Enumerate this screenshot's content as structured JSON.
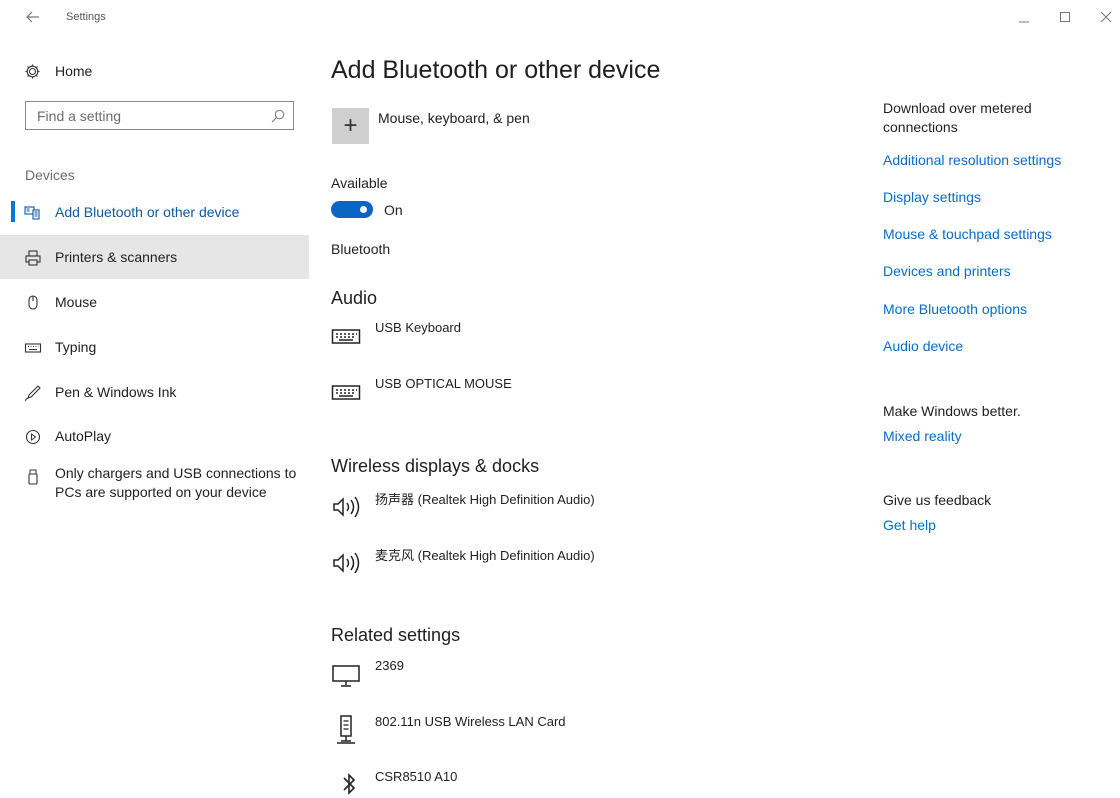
{
  "window": {
    "title": "Settings"
  },
  "sidebar": {
    "home_label": "Home",
    "search_placeholder": "Find a setting",
    "section_label": "Devices",
    "items": [
      {
        "label": "Add Bluetooth or other device",
        "icon": "bluetooth-devices-icon",
        "active": true
      },
      {
        "label": "Printers & scanners",
        "icon": "printer-icon"
      },
      {
        "label": "Mouse",
        "icon": "mouse-icon"
      },
      {
        "label": "Typing",
        "icon": "keyboard-icon"
      },
      {
        "label": "Pen & Windows Ink",
        "icon": "pen-icon"
      },
      {
        "label": "AutoPlay",
        "icon": "autoplay-icon"
      },
      {
        "label": "Only chargers and USB connections to PCs are supported on your device",
        "icon": "usb-icon"
      }
    ]
  },
  "main": {
    "title": "Add Bluetooth or other device",
    "add_device_label": "Mouse, keyboard, & pen",
    "available_label": "Available",
    "toggle_state": "On",
    "bluetooth_label": "Bluetooth",
    "audio_heading": "Audio",
    "audio_devices": [
      {
        "name": "USB Keyboard",
        "icon": "keyboard-icon"
      },
      {
        "name": "USB OPTICAL MOUSE",
        "icon": "keyboard-icon"
      }
    ],
    "wireless_heading": "Wireless displays & docks",
    "wireless_devices": [
      {
        "name": "扬声器 (Realtek High Definition Audio)",
        "icon": "speaker-icon"
      },
      {
        "name": "麦克风 (Realtek High Definition Audio)",
        "icon": "speaker-icon"
      }
    ],
    "related_heading": "Related settings",
    "related_devices": [
      {
        "name": "2369",
        "icon": "monitor-icon"
      },
      {
        "name": "802.11n USB Wireless LAN Card",
        "icon": "network-adapter-icon"
      },
      {
        "name": "CSR8510 A10",
        "icon": "bluetooth-icon"
      }
    ]
  },
  "right_column": {
    "metered_text": "Download over metered connections",
    "links": [
      "Additional resolution settings",
      "Display settings",
      "Mouse & touchpad settings",
      "Devices and printers",
      "More Bluetooth options",
      "Audio device"
    ],
    "better_text": "Make Windows better.",
    "better_link": "Mixed reality",
    "feedback_text": "Give us feedback",
    "feedback_link": "Get help"
  },
  "colors": {
    "accent": "#0078d7",
    "link": "#0a6cc6",
    "hover_bg": "#e6e6e6"
  }
}
